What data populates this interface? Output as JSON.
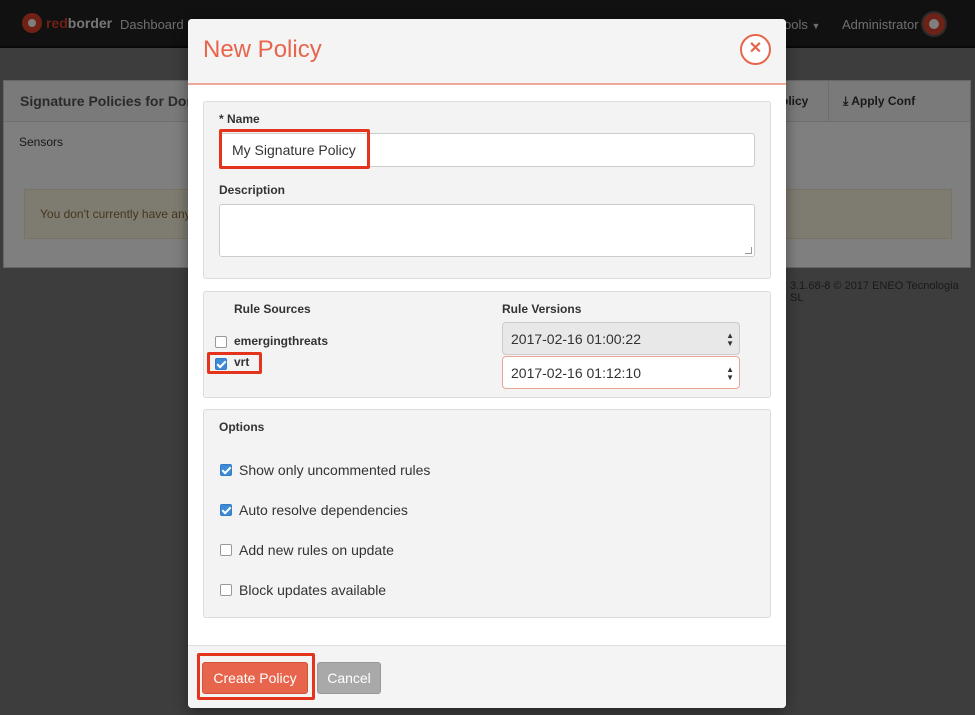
{
  "navbar": {
    "brand_red": "red",
    "brand_white": "border",
    "dashboard": "Dashboard",
    "tools": "ools",
    "admin": "Administrator"
  },
  "background": {
    "panel_title": "Signature Policies for Dom",
    "policy_btn": "olicy",
    "apply_conf": "Apply Conf",
    "sensors": "Sensors",
    "alert": "You don't currently have any",
    "footer": "3.1.68-8 © 2017 ENEO Tecnologia SL"
  },
  "modal": {
    "title": "New Policy",
    "close_icon": "close-icon",
    "name_label": "* Name",
    "name_value": "My Signature Policy",
    "description_label": "Description",
    "description_value": "",
    "rule_sources_label": "Rule Sources",
    "rule_versions_label": "Rule Versions",
    "sources": [
      {
        "label": "emergingthreats",
        "checked": false,
        "version": "2017-02-16 01:00:22"
      },
      {
        "label": "vrt",
        "checked": true,
        "version": "2017-02-16 01:12:10"
      }
    ],
    "options_label": "Options",
    "options": [
      {
        "label": "Show only uncommented rules",
        "checked": true
      },
      {
        "label": "Auto resolve dependencies",
        "checked": true
      },
      {
        "label": "Add new rules on update",
        "checked": false
      },
      {
        "label": "Block updates available",
        "checked": false
      }
    ],
    "create_button": "Create Policy",
    "cancel_button": "Cancel"
  },
  "colors": {
    "accent": "#e8654d",
    "highlight": "#e5341c",
    "checkbox_on": "#3d8bd6"
  }
}
